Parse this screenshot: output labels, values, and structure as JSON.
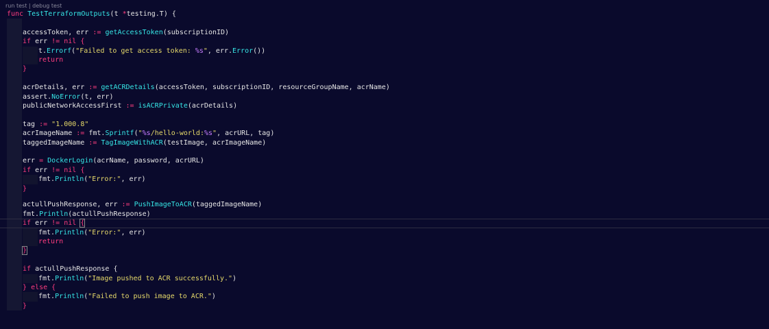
{
  "codelens": {
    "run": "run test",
    "sep": " | ",
    "debug": "debug test"
  },
  "code": {
    "l0": [
      "func",
      "TestTerraformOutputs",
      "(t ",
      "*",
      "testing.T) {"
    ],
    "l2": [
      "accessToken, err ",
      ":=",
      " ",
      "getAccessToken",
      "(subscriptionID)"
    ],
    "l3": [
      "if",
      " err ",
      "!=",
      " ",
      "nil",
      " {"
    ],
    "l4": [
      "t.",
      "Errorf",
      "(",
      "\"Failed to get access token: ",
      "%s",
      "\"",
      ", err.",
      "Error",
      "())"
    ],
    "l5": [
      "return"
    ],
    "l6": [
      "}"
    ],
    "l8": [
      "acrDetails, err ",
      ":=",
      " ",
      "getACRDetails",
      "(accessToken, subscriptionID, resourceGroupName, acrName)"
    ],
    "l9": [
      "assert.",
      "NoError",
      "(t, err)"
    ],
    "l10": [
      "publicNetworkAccessFirst ",
      ":=",
      " ",
      "isACRPrivate",
      "(acrDetails)"
    ],
    "l12": [
      "tag ",
      ":=",
      " ",
      "\"1.000.8\""
    ],
    "l13": [
      "acrImageName ",
      ":=",
      " fmt.",
      "Sprintf",
      "(",
      "\"",
      "%s",
      "/hello-world:",
      "%s",
      "\"",
      ", acrURL, tag)"
    ],
    "l14": [
      "taggedImageName ",
      ":=",
      " ",
      "TagImageWithACR",
      "(testImage, acrImageName)"
    ],
    "l16": [
      "err ",
      "=",
      " ",
      "DockerLogin",
      "(acrName, password, acrURL)"
    ],
    "l17": [
      "if",
      " err ",
      "!=",
      " ",
      "nil",
      " {"
    ],
    "l18": [
      "fmt.",
      "Println",
      "(",
      "\"Error:\"",
      ", err)"
    ],
    "l19": [
      "}"
    ],
    "l21": [
      "actullPushResponse, err ",
      ":=",
      " ",
      "PushImageToACR",
      "(taggedImageName)"
    ],
    "l22": [
      "fmt.",
      "Println",
      "(actullPushResponse)"
    ],
    "l23": [
      "if",
      " err ",
      "!=",
      " ",
      "nil",
      " ",
      "{"
    ],
    "l24": [
      "fmt.",
      "Println",
      "(",
      "\"Error:\"",
      ", err)"
    ],
    "l25": [
      "return"
    ],
    "l26": [
      "}"
    ],
    "l28": [
      "if",
      " actullPushResponse {"
    ],
    "l29": [
      "fmt.",
      "Println",
      "(",
      "\"Image pushed to ACR successfully.\"",
      ")"
    ],
    "l30": [
      "}",
      " ",
      "else",
      " {"
    ],
    "l31": [
      "fmt.",
      "Println",
      "(",
      "\"Failed to push image to ACR.\"",
      ")"
    ],
    "l32": [
      "}"
    ]
  }
}
